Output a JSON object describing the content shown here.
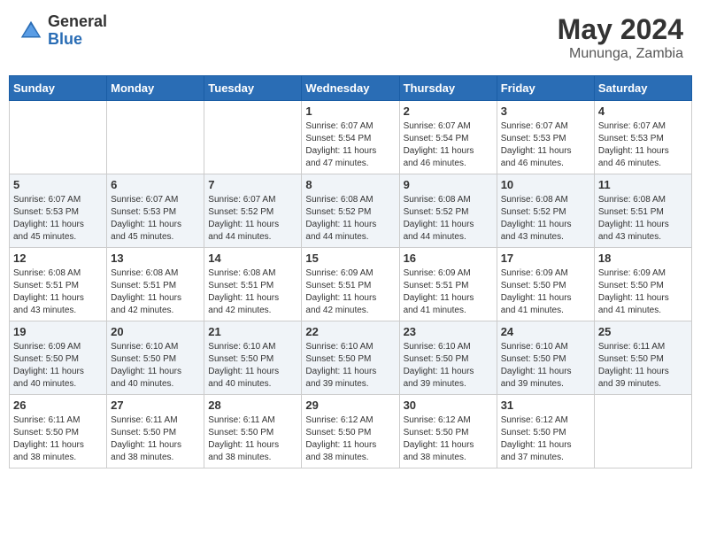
{
  "header": {
    "logo_general": "General",
    "logo_blue": "Blue",
    "month_year": "May 2024",
    "location": "Mununga, Zambia"
  },
  "days_of_week": [
    "Sunday",
    "Monday",
    "Tuesday",
    "Wednesday",
    "Thursday",
    "Friday",
    "Saturday"
  ],
  "weeks": [
    [
      {
        "day": "",
        "info": ""
      },
      {
        "day": "",
        "info": ""
      },
      {
        "day": "",
        "info": ""
      },
      {
        "day": "1",
        "info": "Sunrise: 6:07 AM\nSunset: 5:54 PM\nDaylight: 11 hours\nand 47 minutes."
      },
      {
        "day": "2",
        "info": "Sunrise: 6:07 AM\nSunset: 5:54 PM\nDaylight: 11 hours\nand 46 minutes."
      },
      {
        "day": "3",
        "info": "Sunrise: 6:07 AM\nSunset: 5:53 PM\nDaylight: 11 hours\nand 46 minutes."
      },
      {
        "day": "4",
        "info": "Sunrise: 6:07 AM\nSunset: 5:53 PM\nDaylight: 11 hours\nand 46 minutes."
      }
    ],
    [
      {
        "day": "5",
        "info": "Sunrise: 6:07 AM\nSunset: 5:53 PM\nDaylight: 11 hours\nand 45 minutes."
      },
      {
        "day": "6",
        "info": "Sunrise: 6:07 AM\nSunset: 5:53 PM\nDaylight: 11 hours\nand 45 minutes."
      },
      {
        "day": "7",
        "info": "Sunrise: 6:07 AM\nSunset: 5:52 PM\nDaylight: 11 hours\nand 44 minutes."
      },
      {
        "day": "8",
        "info": "Sunrise: 6:08 AM\nSunset: 5:52 PM\nDaylight: 11 hours\nand 44 minutes."
      },
      {
        "day": "9",
        "info": "Sunrise: 6:08 AM\nSunset: 5:52 PM\nDaylight: 11 hours\nand 44 minutes."
      },
      {
        "day": "10",
        "info": "Sunrise: 6:08 AM\nSunset: 5:52 PM\nDaylight: 11 hours\nand 43 minutes."
      },
      {
        "day": "11",
        "info": "Sunrise: 6:08 AM\nSunset: 5:51 PM\nDaylight: 11 hours\nand 43 minutes."
      }
    ],
    [
      {
        "day": "12",
        "info": "Sunrise: 6:08 AM\nSunset: 5:51 PM\nDaylight: 11 hours\nand 43 minutes."
      },
      {
        "day": "13",
        "info": "Sunrise: 6:08 AM\nSunset: 5:51 PM\nDaylight: 11 hours\nand 42 minutes."
      },
      {
        "day": "14",
        "info": "Sunrise: 6:08 AM\nSunset: 5:51 PM\nDaylight: 11 hours\nand 42 minutes."
      },
      {
        "day": "15",
        "info": "Sunrise: 6:09 AM\nSunset: 5:51 PM\nDaylight: 11 hours\nand 42 minutes."
      },
      {
        "day": "16",
        "info": "Sunrise: 6:09 AM\nSunset: 5:51 PM\nDaylight: 11 hours\nand 41 minutes."
      },
      {
        "day": "17",
        "info": "Sunrise: 6:09 AM\nSunset: 5:50 PM\nDaylight: 11 hours\nand 41 minutes."
      },
      {
        "day": "18",
        "info": "Sunrise: 6:09 AM\nSunset: 5:50 PM\nDaylight: 11 hours\nand 41 minutes."
      }
    ],
    [
      {
        "day": "19",
        "info": "Sunrise: 6:09 AM\nSunset: 5:50 PM\nDaylight: 11 hours\nand 40 minutes."
      },
      {
        "day": "20",
        "info": "Sunrise: 6:10 AM\nSunset: 5:50 PM\nDaylight: 11 hours\nand 40 minutes."
      },
      {
        "day": "21",
        "info": "Sunrise: 6:10 AM\nSunset: 5:50 PM\nDaylight: 11 hours\nand 40 minutes."
      },
      {
        "day": "22",
        "info": "Sunrise: 6:10 AM\nSunset: 5:50 PM\nDaylight: 11 hours\nand 39 minutes."
      },
      {
        "day": "23",
        "info": "Sunrise: 6:10 AM\nSunset: 5:50 PM\nDaylight: 11 hours\nand 39 minutes."
      },
      {
        "day": "24",
        "info": "Sunrise: 6:10 AM\nSunset: 5:50 PM\nDaylight: 11 hours\nand 39 minutes."
      },
      {
        "day": "25",
        "info": "Sunrise: 6:11 AM\nSunset: 5:50 PM\nDaylight: 11 hours\nand 39 minutes."
      }
    ],
    [
      {
        "day": "26",
        "info": "Sunrise: 6:11 AM\nSunset: 5:50 PM\nDaylight: 11 hours\nand 38 minutes."
      },
      {
        "day": "27",
        "info": "Sunrise: 6:11 AM\nSunset: 5:50 PM\nDaylight: 11 hours\nand 38 minutes."
      },
      {
        "day": "28",
        "info": "Sunrise: 6:11 AM\nSunset: 5:50 PM\nDaylight: 11 hours\nand 38 minutes."
      },
      {
        "day": "29",
        "info": "Sunrise: 6:12 AM\nSunset: 5:50 PM\nDaylight: 11 hours\nand 38 minutes."
      },
      {
        "day": "30",
        "info": "Sunrise: 6:12 AM\nSunset: 5:50 PM\nDaylight: 11 hours\nand 38 minutes."
      },
      {
        "day": "31",
        "info": "Sunrise: 6:12 AM\nSunset: 5:50 PM\nDaylight: 11 hours\nand 37 minutes."
      },
      {
        "day": "",
        "info": ""
      }
    ]
  ]
}
